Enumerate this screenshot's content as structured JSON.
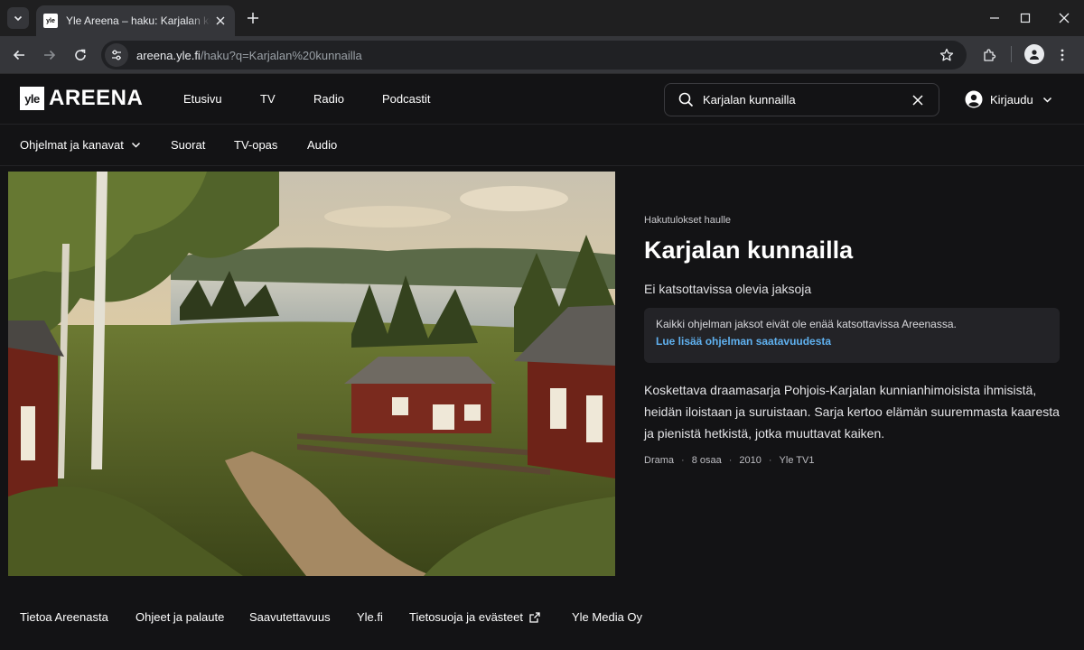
{
  "browser": {
    "tab_title": "Yle Areena – haku: Karjalan kunnailla",
    "favicon_text": "yle",
    "url_host": "areena.yle.fi",
    "url_path": "/haku?q=Karjalan%20kunnailla"
  },
  "header": {
    "logo_yle": "yle",
    "logo_word": "AREENA",
    "nav": [
      "Etusivu",
      "TV",
      "Radio",
      "Podcastit"
    ],
    "search_value": "Karjalan kunnailla",
    "login_label": "Kirjaudu"
  },
  "subnav": {
    "programs_label": "Ohjelmat ja kanavat",
    "live_label": "Suorat",
    "guide_label": "TV-opas",
    "audio_label": "Audio"
  },
  "result": {
    "kicker": "Hakutulokset haulle",
    "title": "Karjalan kunnailla",
    "subtitle": "Ei katsottavissa olevia jaksoja",
    "notice_text": "Kaikki ohjelman jaksot eivät ole enää katsottavissa Areenassa.",
    "notice_link": "Lue lisää ohjelman saatavuudesta",
    "description": "Koskettava draamasarja Pohjois-Karjalan kunnianhimoisista ihmisistä, heidän iloistaan ja suruistaan. Sarja kertoo elämän suuremmasta kaaresta ja pienistä hetkistä, jotka muuttavat kaiken.",
    "meta": {
      "genre": "Drama",
      "episodes": "8 osaa",
      "year": "2010",
      "channel": "Yle TV1"
    }
  },
  "footer": {
    "links": [
      "Tietoa Areenasta",
      "Ohjeet ja palaute",
      "Saavutettavuus",
      "Yle.fi",
      "Tietosuoja ja evästeet",
      "Yle Media Oy"
    ]
  },
  "colors": {
    "page_bg": "#131315",
    "link_blue": "#5fb0ee",
    "notice_bg": "#232327"
  }
}
